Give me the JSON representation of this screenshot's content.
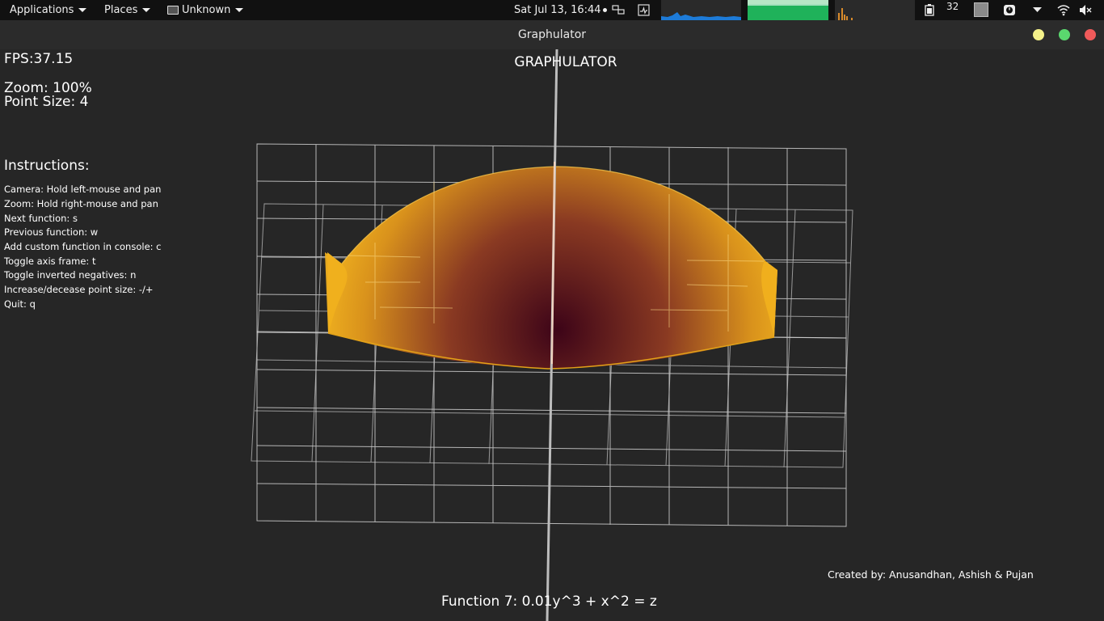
{
  "topbar": {
    "applications_label": "Applications",
    "places_label": "Places",
    "window_menu_label": "Unknown",
    "clock": "Sat Jul 13, 16:44",
    "indicator_number": "32",
    "bg_color": "#111111"
  },
  "titlebar": {
    "title": "Graphulator",
    "buttons": {
      "minimize_color": "#f4f18a",
      "maximize_color": "#5ad86e",
      "close_color": "#f05a5a"
    }
  },
  "app": {
    "title": "GRAPHULATOR",
    "fps": "FPS:37.15",
    "zoom": "Zoom: 100%",
    "point_size": "Point Size: 4",
    "instructions_heading": "Instructions:",
    "instructions": [
      "Camera:  Hold left-mouse and pan",
      "Zoom:  Hold right-mouse and pan",
      "Next function:  s",
      "Previous function:  w",
      "Add custom function in console:  c",
      "Toggle axis frame:  t",
      "Toggle inverted negatives:  n",
      "Increase/decease point size:  -/+",
      "Quit: q"
    ],
    "credits": "Created by: Anusandhan, Ashish & Pujan",
    "function_label": "Function 7: 0.01y^3 + x^2 = z",
    "surface_colors": {
      "edge": "#f2b51f",
      "center": "#3d0418"
    }
  }
}
